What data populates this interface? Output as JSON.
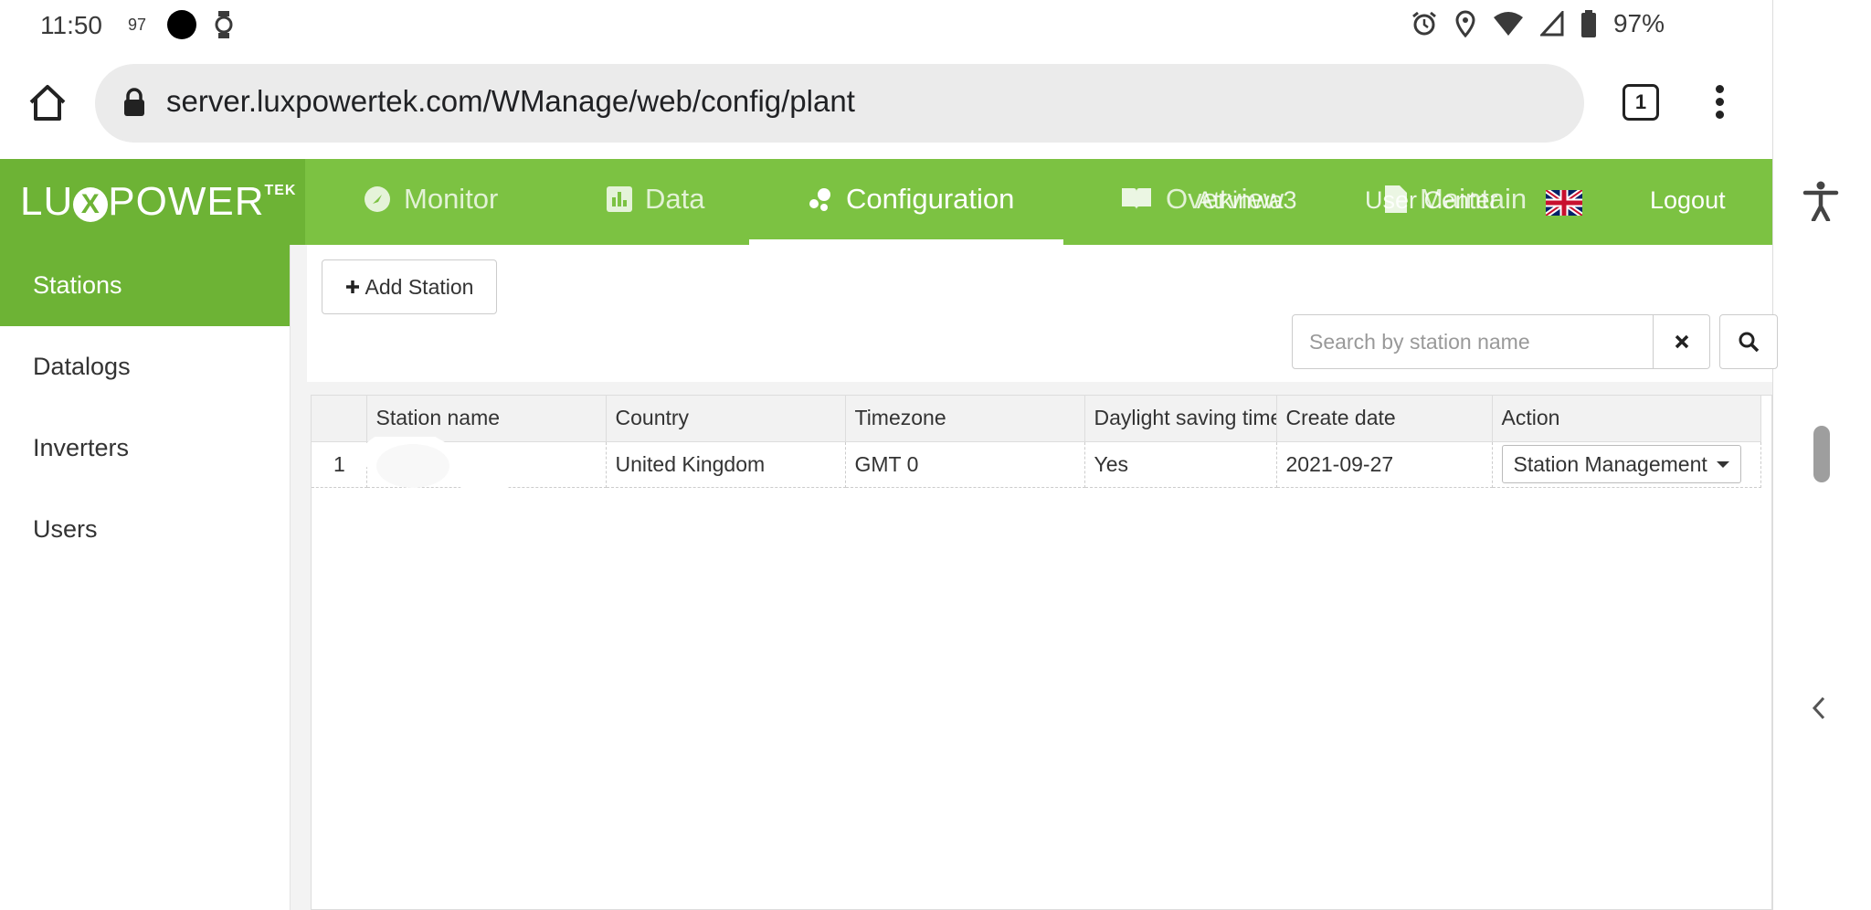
{
  "status_bar": {
    "time": "11:50",
    "notif_count": "97",
    "battery": "97%"
  },
  "browser": {
    "url": "server.luxpowertek.com/WManage/web/config/plant",
    "tab_count": "1"
  },
  "brand": {
    "logo_left": "LU",
    "logo_x": "X",
    "logo_right": "POWER",
    "logo_tek": "TEK",
    "primary_color": "#7cc242",
    "accent_color": "#6db335"
  },
  "nav": {
    "items": [
      {
        "label": "Monitor",
        "icon": "monitor-icon"
      },
      {
        "label": "Data",
        "icon": "chart-icon"
      },
      {
        "label": "Configuration",
        "icon": "config-icon"
      },
      {
        "label": "Overview",
        "icon": "book-icon"
      },
      {
        "label": "Maintain",
        "icon": "document-icon"
      }
    ],
    "user": "Atkinwa3",
    "user_center": "User Center",
    "logout": "Logout"
  },
  "sidebar": {
    "items": [
      {
        "label": "Stations"
      },
      {
        "label": "Datalogs"
      },
      {
        "label": "Inverters"
      },
      {
        "label": "Users"
      }
    ]
  },
  "toolbar": {
    "add_label": "Add Station",
    "search_placeholder": "Search by station name"
  },
  "table": {
    "headers": [
      "Station name",
      "Country",
      "Timezone",
      "Daylight saving time",
      "Create date",
      "Action"
    ],
    "rows": [
      {
        "index": "1",
        "station_name": "",
        "country": "United Kingdom",
        "timezone": "GMT 0",
        "dst": "Yes",
        "create_date": "2021-09-27",
        "action": "Station Management"
      }
    ]
  }
}
